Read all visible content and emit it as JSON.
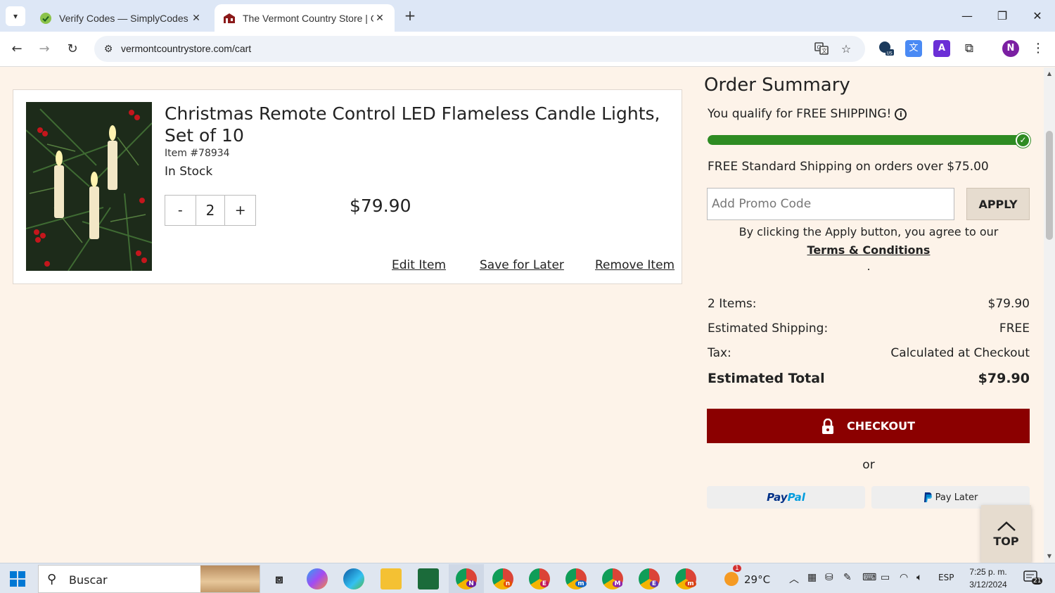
{
  "browser": {
    "tabs": [
      {
        "title": "Verify Codes — SimplyCodes",
        "active": false
      },
      {
        "title": "The Vermont Country Store | Ge",
        "active": true
      }
    ],
    "url": "vermontcountrystore.com/cart",
    "profile_initial": "N"
  },
  "cart_item": {
    "name": "Christmas Remote Control LED Flameless Candle Lights, Set of 10",
    "item_number": "Item #78934",
    "stock": "In Stock",
    "qty_minus": "-",
    "quantity": "2",
    "qty_plus": "+",
    "price": "$79.90",
    "edit_label": "Edit Item",
    "save_label": "Save for Later",
    "remove_label": "Remove Item"
  },
  "summary": {
    "title": "Order Summary",
    "shipping_qualify": "You qualify for FREE SHIPPING!",
    "shipping_progress": 1.0,
    "shipping_note": "FREE Standard Shipping on orders over $75.00",
    "promo_placeholder": "Add Promo Code",
    "apply_label": "APPLY",
    "agree_text": "By clicking the Apply button, you agree to our",
    "terms_link": "Terms & Conditions",
    "terms_suffix": ".",
    "items_label": "2 Items:",
    "items_value": "$79.90",
    "shipping_label": "Estimated Shipping:",
    "shipping_value": "FREE",
    "tax_label": "Tax:",
    "tax_value": "Calculated at Checkout",
    "total_label": "Estimated Total",
    "total_value": "$79.90",
    "checkout_label": "CHECKOUT",
    "or_label": "or",
    "paypal_pay": "Pay",
    "paypal_pal": "Pal",
    "paylater_label": "Pay Later",
    "top_label": "TOP"
  },
  "taskbar": {
    "search_text": "Buscar",
    "weather": "29°C",
    "language": "ESP",
    "time": "7:25 p. m.",
    "date": "3/12/2024",
    "notifications": "21",
    "weather_badge": "1"
  },
  "colors": {
    "page_bg": "#fdf3e9",
    "checkout_red": "#8b0000",
    "progress_green": "#2e8b22",
    "apply_bg": "#e6dccf"
  }
}
